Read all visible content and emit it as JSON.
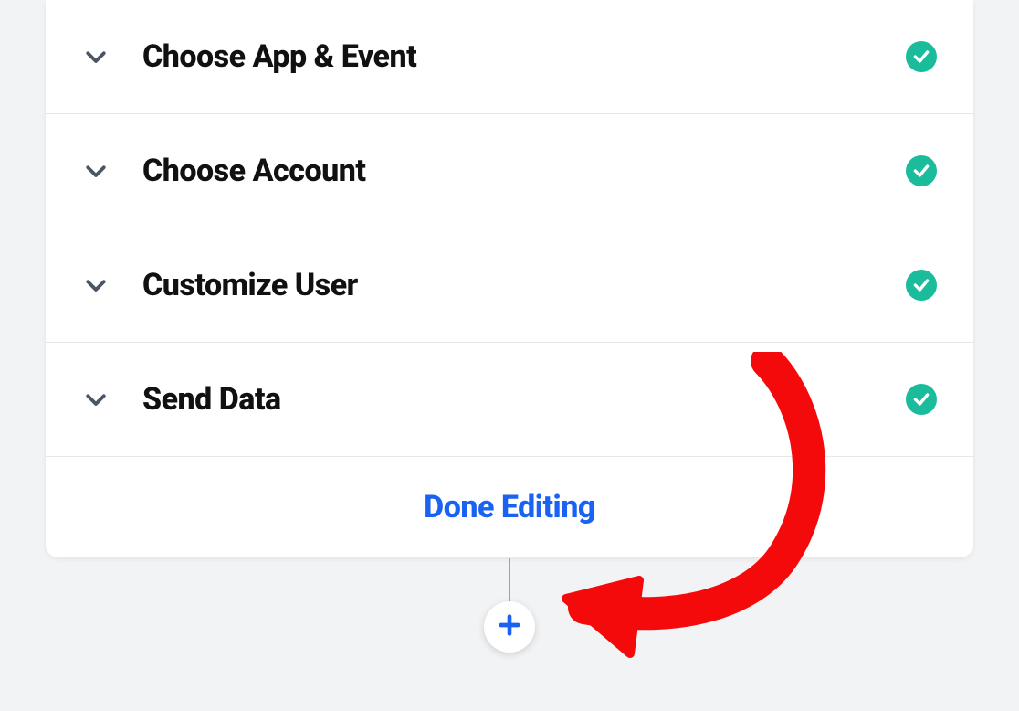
{
  "steps": [
    {
      "label": "Choose App & Event",
      "complete": true
    },
    {
      "label": "Choose Account",
      "complete": true
    },
    {
      "label": "Customize User",
      "complete": true
    },
    {
      "label": "Send Data",
      "complete": true
    }
  ],
  "done_label": "Done Editing",
  "colors": {
    "accent": "#1a63f2",
    "success": "#1abc9c",
    "annotation": "#f40a0a"
  }
}
